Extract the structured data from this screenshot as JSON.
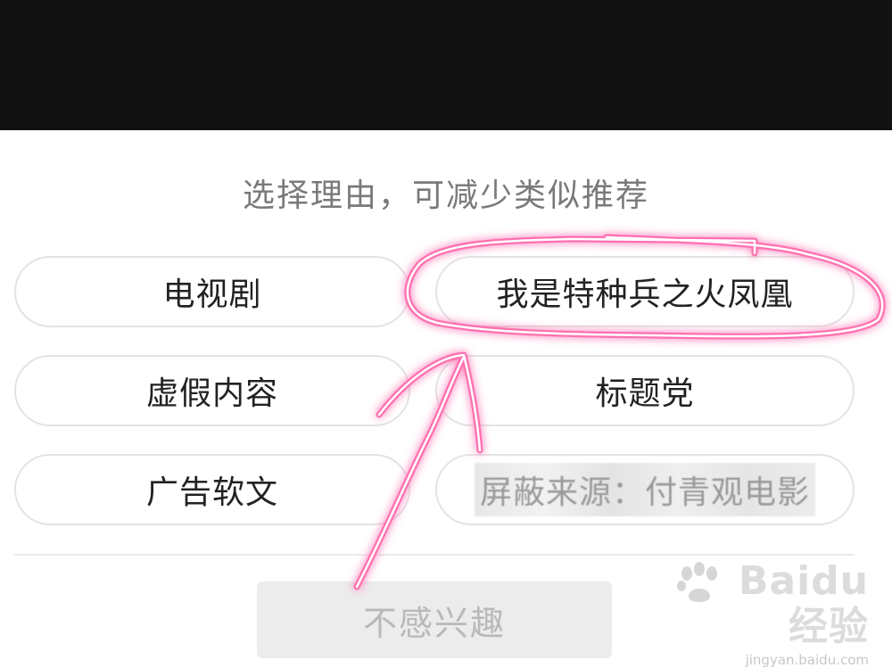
{
  "dialog": {
    "title": "选择理由，可减少类似推荐",
    "reasons": [
      {
        "label": "电视剧"
      },
      {
        "label": "我是特种兵之火凤凰"
      },
      {
        "label": "虚假内容"
      },
      {
        "label": "标题党"
      },
      {
        "label": "广告软文"
      },
      {
        "label": "屏蔽来源：付青观电影"
      }
    ],
    "not_interested_label": "不感兴趣"
  },
  "watermark": {
    "brand": "Baidu经验",
    "url": "jingyan.baidu.com"
  },
  "colors": {
    "top_bar": "#121212",
    "chip_border": "#e3e3e3",
    "annotation": "#ff5fa8",
    "disabled_button": "#ececec"
  }
}
